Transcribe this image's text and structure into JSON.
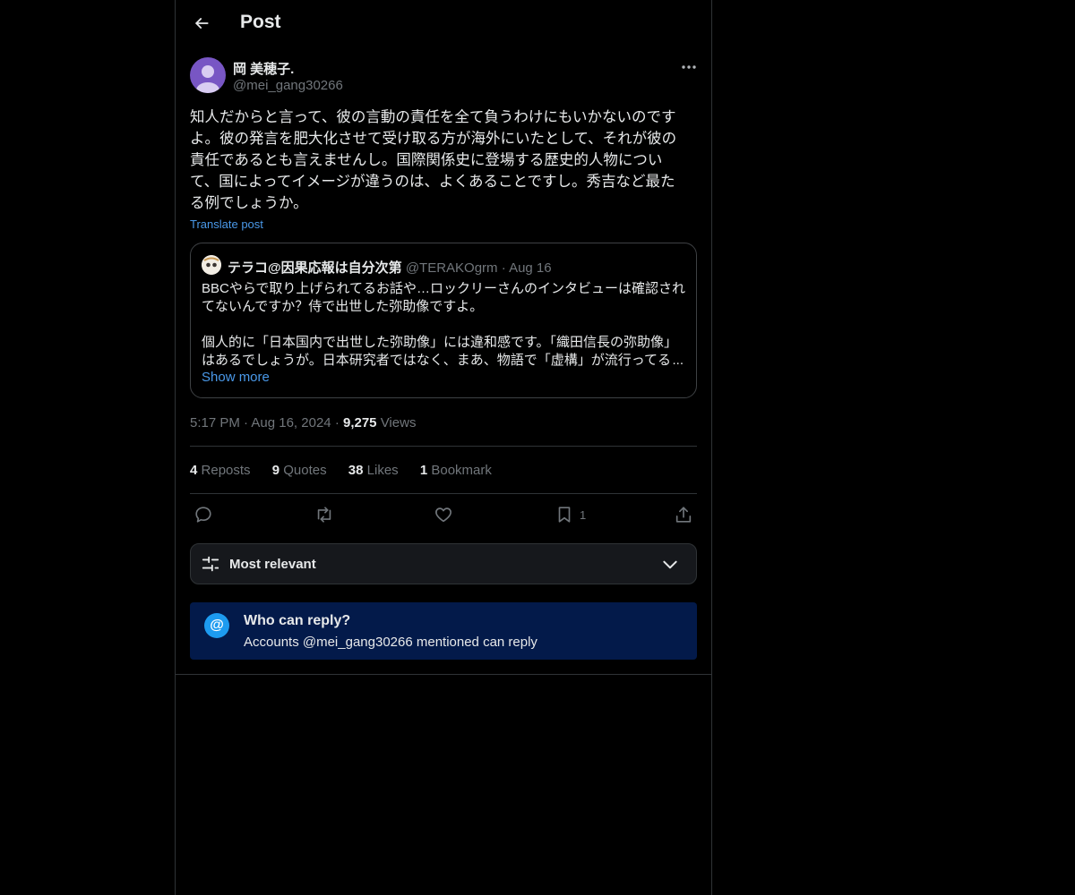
{
  "header": {
    "title": "Post"
  },
  "post": {
    "author_name": "岡 美穂子.",
    "author_handle": "@mei_gang30266",
    "text": "知人だからと言って、彼の言動の責任を全て負うわけにもいかないのです\nよ。彼の発言を肥大化させて受け取る方が海外にいたとして、それが彼の\n責任であるとも言えませんし。国際関係史に登場する歴史的人物につい\nて、国によってイメージが違うのは、よくあることですし。秀吉など最た\nる例でしょうか。",
    "translate_label": "Translate post"
  },
  "quote": {
    "name": "テラコ@因果応報は自分次第",
    "handle": "@TERAKOgrm",
    "dot": "·",
    "date": "Aug 16",
    "text": "BBCやらで取り上げられてるお話や…ロックリーさんのインタビューは確認され\nてないんですか？侍で出世した弥助像ですよ。\n\n個人的に「日本国内で出世した弥助像」には違和感です。「織田信長の弥助像」\nはあるでしょうが。日本研究者ではなく、まあ、物語で「虚構」が流行ってる",
    "ellipsis": "...",
    "show_more": "Show more"
  },
  "meta": {
    "time": "5:17 PM",
    "dot": "·",
    "date": "Aug 16, 2024",
    "views_count": "9,275",
    "views_label": "Views"
  },
  "stats": [
    {
      "count": "4",
      "label": "Reposts"
    },
    {
      "count": "9",
      "label": "Quotes"
    },
    {
      "count": "38",
      "label": "Likes"
    },
    {
      "count": "1",
      "label": "Bookmark"
    }
  ],
  "actions": {
    "bookmark_count": "1"
  },
  "sort": {
    "label": "Most relevant"
  },
  "reply_info": {
    "at_symbol": "@",
    "title": "Who can reply?",
    "subtitle": "Accounts @mei_gang30266 mentioned can reply"
  },
  "icons": {
    "back": "arrow-left-icon",
    "more": "more-horizontal-icon",
    "reply": "reply-icon",
    "repost": "repost-icon",
    "like": "heart-icon",
    "bookmark": "bookmark-icon",
    "share": "share-icon",
    "sort": "sliders-icon",
    "chevron": "chevron-down-icon"
  },
  "colors": {
    "background": "#000000",
    "text": "#e7e9ea",
    "secondary": "#71767b",
    "link": "#4a99e9",
    "accent": "#1d9bf0",
    "info_box": "#031a4a"
  }
}
